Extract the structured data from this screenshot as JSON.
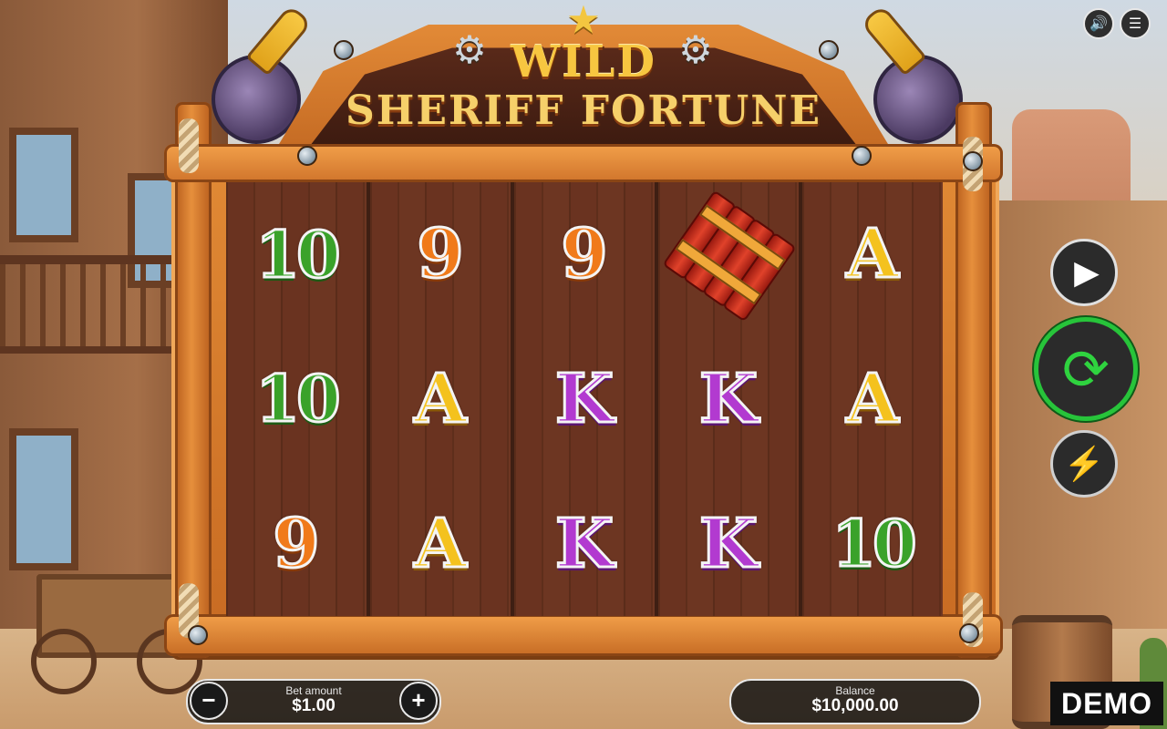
{
  "game": {
    "title_line1": "WILD",
    "title_line2": "SHERIFF FORTUNE"
  },
  "reels": [
    [
      "10",
      "10",
      "9"
    ],
    [
      "9",
      "A",
      "A"
    ],
    [
      "9",
      "K",
      "K"
    ],
    [
      "dynamite",
      "K",
      "K"
    ],
    [
      "A",
      "A",
      "10"
    ]
  ],
  "controls": {
    "sound_icon": "speaker-icon",
    "menu_icon": "hamburger-menu-icon",
    "autoplay_icon": "play-icon",
    "spin_icon": "refresh-arrows-icon",
    "turbo_icon": "lightning-icon",
    "decrease_label": "−",
    "increase_label": "+"
  },
  "bet": {
    "label": "Bet amount",
    "value": "$1.00"
  },
  "balance": {
    "label": "Balance",
    "value": "$10,000.00"
  },
  "mode_badge": "DEMO",
  "colors": {
    "spin_accent": "#27c43a",
    "symbol_10": "#3aa22a",
    "symbol_9": "#f07a1a",
    "symbol_A": "#f4c21e",
    "symbol_K": "#b23ad0",
    "frame_wood": "#d0742b"
  }
}
